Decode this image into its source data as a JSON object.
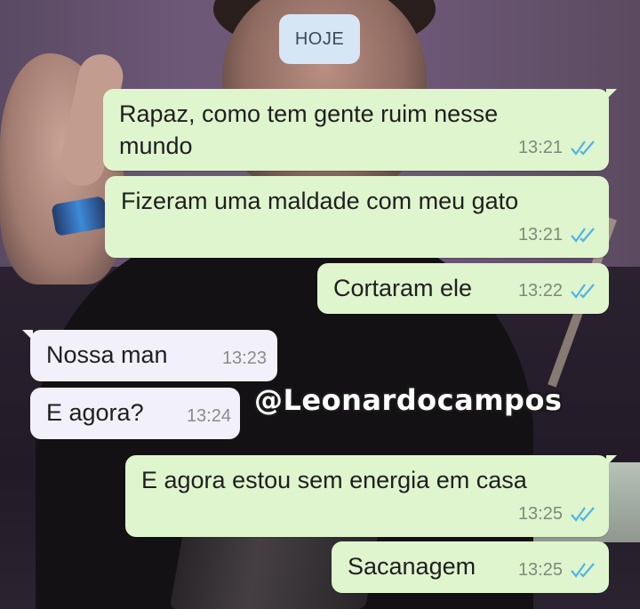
{
  "chat": {
    "date_label": "HOJE",
    "messages": [
      {
        "direction": "out",
        "text": "Rapaz, como tem gente ruim nesse mundo",
        "time": "13:21",
        "status": "read"
      },
      {
        "direction": "out",
        "text": "Fizeram uma maldade com meu gato",
        "time": "13:21",
        "status": "read"
      },
      {
        "direction": "out",
        "text": "Cortaram ele",
        "time": "13:22",
        "status": "read"
      },
      {
        "direction": "in",
        "text": "Nossa man",
        "time": "13:23"
      },
      {
        "direction": "in",
        "text": "E agora?",
        "time": "13:24"
      },
      {
        "direction": "out",
        "text": "E agora estou sem energia em casa",
        "time": "13:25",
        "status": "read"
      },
      {
        "direction": "out",
        "text": "Sacanagem",
        "time": "13:25",
        "status": "read"
      }
    ]
  },
  "watermark": "@Leonardocampos",
  "icons": {
    "read_receipt": "double-check-icon"
  },
  "colors": {
    "outgoing_bubble": "#dff5cd",
    "incoming_bubble": "#f2f0fb",
    "date_pill": "#d6e6f5",
    "read_tick": "#4fb3e8"
  }
}
